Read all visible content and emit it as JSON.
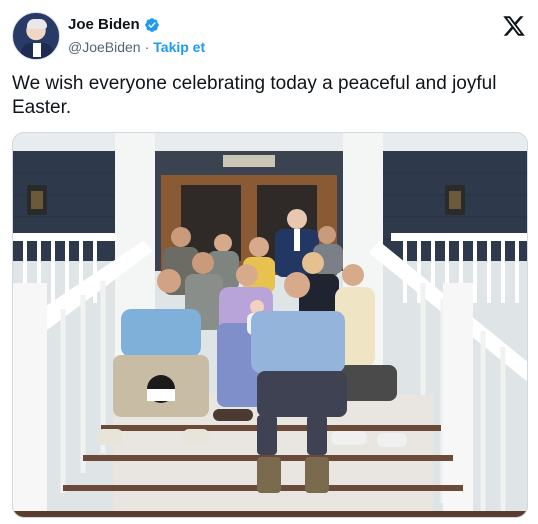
{
  "author": {
    "name": "Joe Biden",
    "handle": "@JoeBiden",
    "separator": "·",
    "follow_label": "Takip et",
    "verified": true
  },
  "tweet": {
    "text": "We wish everyone celebrating today a peaceful and joyful Easter."
  },
  "icons": {
    "brand": "x-logo-icon",
    "verified": "verified-badge-icon"
  },
  "colors": {
    "accent": "#1d9bf0",
    "text": "#0f1419",
    "secondary": "#536471"
  }
}
